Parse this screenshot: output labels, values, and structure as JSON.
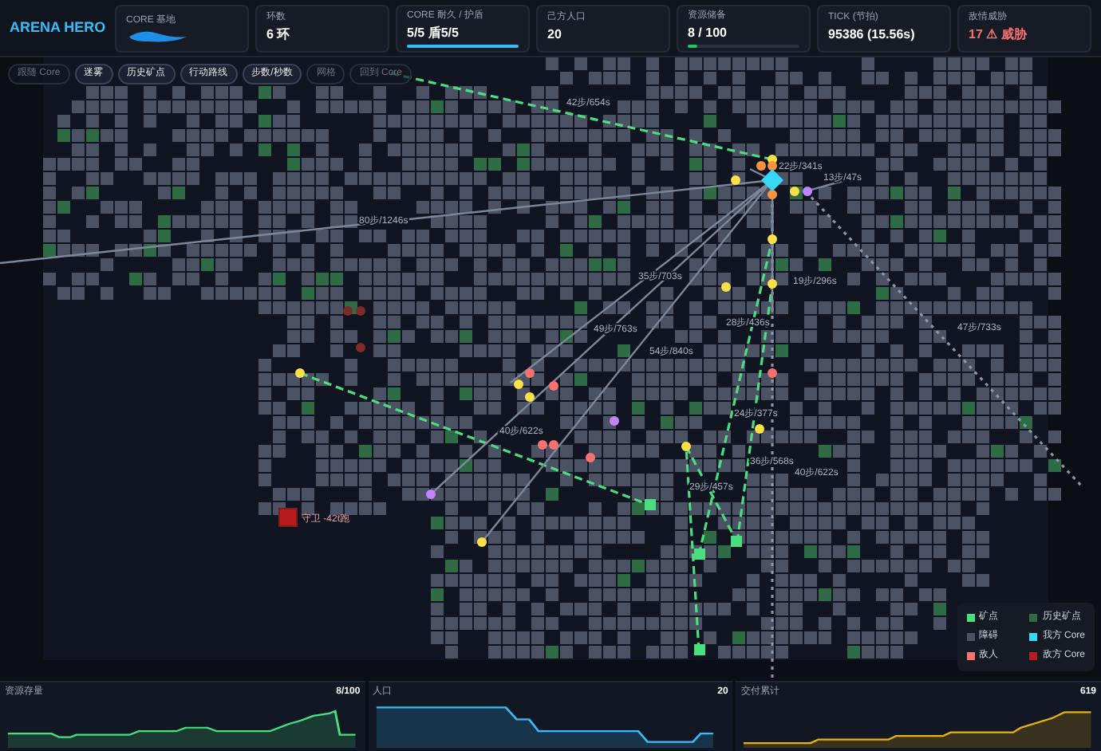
{
  "brand": "ARENA HERO",
  "stats": [
    {
      "kind": "redacted",
      "label": "CORE 基地"
    },
    {
      "kind": "plain",
      "label": "环数",
      "value": "6 环"
    },
    {
      "kind": "bar",
      "label": "CORE 耐久 / 护盾",
      "value": "5/5 盾5/5",
      "level": 1
    },
    {
      "kind": "plain",
      "label": "己方人口",
      "value": "20"
    },
    {
      "kind": "bar",
      "label": "资源储备",
      "value": "8 / 100",
      "level": 0.08
    },
    {
      "kind": "plain",
      "label": "TICK (节拍)",
      "value": "95386 (15.56s)"
    },
    {
      "kind": "alert",
      "label": "敌情威胁",
      "value": "17 ⚠ 威胁"
    }
  ],
  "toolbar": [
    {
      "label": "跟随 Core",
      "selected": false
    },
    {
      "label": "迷雾",
      "selected": true
    },
    {
      "label": "历史矿点",
      "selected": true
    },
    {
      "label": "行动路线",
      "selected": true
    },
    {
      "label": "步数/秒数",
      "selected": true
    },
    {
      "label": "网格",
      "selected": false
    },
    {
      "label": "回到 Core",
      "selected": false
    }
  ],
  "routes": [
    {
      "kind": "planned",
      "label": "42步/654s"
    },
    {
      "kind": "path",
      "label": "80步/1246s"
    },
    {
      "kind": "trail",
      "label": "47步/733s"
    },
    {
      "kind": "planned",
      "label": "40步/622s"
    },
    {
      "kind": "path",
      "label": "49步/763s"
    },
    {
      "kind": "path",
      "label": "54步/840s"
    },
    {
      "kind": "planned",
      "label": "28步/436s"
    },
    {
      "kind": "planned",
      "label": "24步/377s"
    },
    {
      "kind": "planned",
      "label": "36步/568s"
    },
    {
      "kind": "trail",
      "label": "40步/622s"
    },
    {
      "kind": "planned",
      "label": "29步/457s"
    },
    {
      "kind": "path",
      "label": "13步/47s"
    },
    {
      "kind": "path",
      "label": "19步/296s"
    },
    {
      "kind": "path",
      "label": "35步/703s"
    },
    {
      "kind": "path",
      "label": "22步/341s"
    }
  ],
  "enemy_core": {
    "label": "守卫 -42t跑"
  },
  "legend": [
    {
      "label": "矿点",
      "color": "#4ade80"
    },
    {
      "label": "历史矿点",
      "color": "#2f6b45"
    },
    {
      "label": "障碍",
      "color": "#4b5263"
    },
    {
      "label": "我方 Core",
      "color": "#38d6f8"
    },
    {
      "label": "敌人",
      "color": "#f87171"
    },
    {
      "label": "敌方 Core",
      "color": "#b91c1c"
    }
  ],
  "charts": [
    {
      "title": "资源存量",
      "value": "8/100",
      "color": "#4ade80"
    },
    {
      "title": "人口",
      "value": "20",
      "color": "#38bdf8"
    },
    {
      "title": "交付累计",
      "value": "619",
      "color": "#eab308"
    }
  ]
}
